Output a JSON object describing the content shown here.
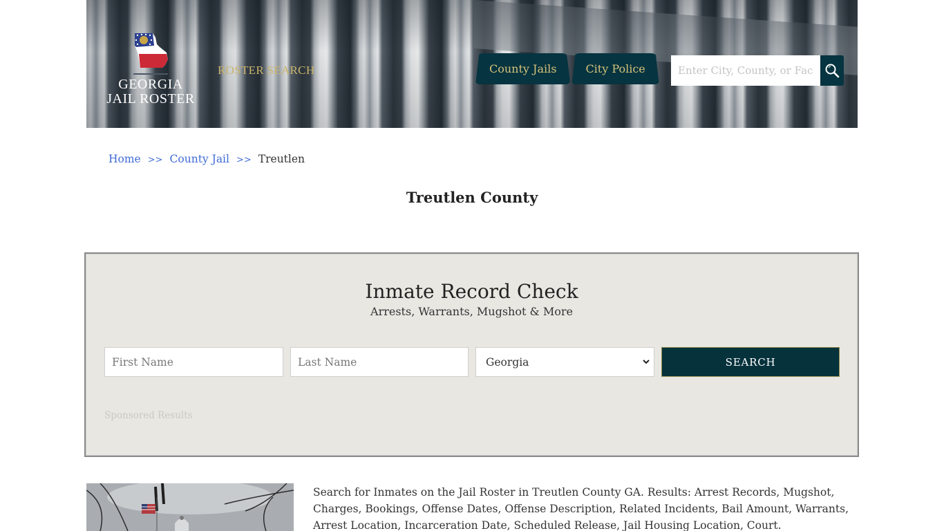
{
  "header": {
    "logo": {
      "line1": "GEORGIA",
      "line2": "JAIL ROSTER",
      "icon": "georgia-state-flag-map-icon"
    },
    "roster_search_label": "ROSTER SEARCH",
    "nav_tabs": [
      {
        "label": "County Jails"
      },
      {
        "label": "City Police"
      }
    ],
    "search": {
      "placeholder": "Enter City, County, or Facility",
      "icon": "search-icon"
    }
  },
  "breadcrumb": {
    "items": [
      {
        "label": "Home",
        "link": true
      },
      {
        "label": "County Jail",
        "link": true
      },
      {
        "label": "Treutlen",
        "link": false
      }
    ],
    "separator": ">>"
  },
  "page_title": "Treutlen County",
  "record_check": {
    "title": "Inmate Record Check",
    "subtitle": "Arrests, Warrants, Mugshot & More",
    "first_name_placeholder": "First Name",
    "last_name_placeholder": "Last Name",
    "state_selected": "Georgia",
    "search_button": "SEARCH",
    "sponsored_label": "Sponsored Results"
  },
  "content": {
    "photo_alt": "Treutlen County courthouse with flag and trees",
    "description": "Search for Inmates on the Jail Roster in Treutlen County GA. Results: Arrest Records, Mugshot, Charges, Bookings, Offense Dates, Offense Description, Related Incidents, Bail Amount, Warrants, Arrest Location, Incarceration Date, Scheduled Release, Jail Housing Location, Court."
  },
  "colors": {
    "brand_dark": "#063440",
    "brand_gold": "#d6c27a",
    "link_blue": "#3f6bd6",
    "panel_bg": "#e8e7e2"
  }
}
